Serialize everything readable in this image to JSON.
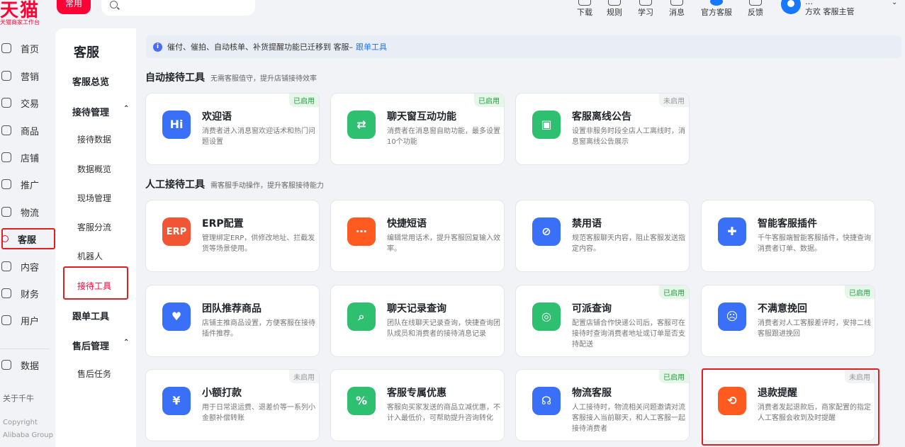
{
  "brand": {
    "logo": "天猫",
    "subtitle": "天猫商家工作台"
  },
  "topbar": {
    "common_tab": "常用",
    "tools": [
      {
        "label": "下载",
        "icon": "download-icon"
      },
      {
        "label": "规则",
        "icon": "rules-icon"
      },
      {
        "label": "学习",
        "icon": "learn-icon"
      },
      {
        "label": "消息",
        "icon": "message-icon"
      },
      {
        "label": "官方客服",
        "icon": "support-icon"
      },
      {
        "label": "反馈",
        "icon": "feedback-icon"
      }
    ],
    "user": {
      "name": "…",
      "role": "方欢  客服主管"
    }
  },
  "leftnav": {
    "items": [
      {
        "label": "首页"
      },
      {
        "label": "营销"
      },
      {
        "label": "交易"
      },
      {
        "label": "商品"
      },
      {
        "label": "店铺"
      },
      {
        "label": "推广"
      },
      {
        "label": "物流"
      },
      {
        "label": "客服"
      },
      {
        "label": "内容"
      },
      {
        "label": "财务"
      },
      {
        "label": "用户"
      },
      {
        "label": "数据"
      }
    ],
    "about": "关于千牛",
    "copyright_1": "Copyright",
    "copyright_2": "Alibaba Group"
  },
  "subnav": {
    "title": "客服",
    "overview": "客服总览",
    "group1": "接待管理",
    "group1_items": [
      "接待数据",
      "数据概览",
      "现场管理",
      "客服分流",
      "机器人",
      "接待工具"
    ],
    "group2": "跟单工具",
    "group3": "售后管理",
    "group3_items": [
      "售后任务"
    ]
  },
  "notice": {
    "text": "催付、催拍、自动核单、补货提醒功能已迁移到 客服–",
    "link": "跟单工具"
  },
  "sections": {
    "auto": {
      "title": "自动接待工具",
      "subtitle": "无需客服值守，提升店铺接待效率"
    },
    "manual": {
      "title": "人工接待工具",
      "subtitle": "需客服手动操作，提升客服接待能力"
    }
  },
  "cards": [
    {
      "title": "欢迎语",
      "desc": "消费者进入消息窗欢迎话术和热门问题设置",
      "badge": "已启用",
      "status": "on",
      "icon": "hi-icon",
      "glyph": "Hi",
      "color": "#3a6ff7"
    },
    {
      "title": "聊天窗互动功能",
      "desc": "消费者在消息窗自助功能，最多设置10个功能",
      "badge": "已启用",
      "status": "on",
      "icon": "swap-icon",
      "glyph": "⇄",
      "color": "#2fbf71"
    },
    {
      "title": "客服离线公告",
      "desc": "设置非服务时段全店人工离线时，消息窗离线公告展示",
      "badge": "未启用",
      "status": "off",
      "icon": "screen-icon",
      "glyph": "▣",
      "color": "#2fbf71"
    },
    {
      "title": "ERP配置",
      "desc": "管理绑定ERP，供修改地址、拦截发货等场景使用。",
      "badge": "",
      "status": "",
      "icon": "erp-icon",
      "glyph": "ERP",
      "color": "#f25533"
    },
    {
      "title": "快捷短语",
      "desc": "编辑常用话术，提升客服回复输入效率。",
      "badge": "",
      "status": "",
      "icon": "quick-phrase-icon",
      "glyph": "⋯",
      "color": "#ff5a1f"
    },
    {
      "title": "禁用语",
      "desc": "规范客服聊天内容，阻止客服发送指定内容。",
      "badge": "",
      "status": "",
      "icon": "ban-icon",
      "glyph": "⊘",
      "color": "#3a6ff7"
    },
    {
      "title": "智能客服插件",
      "desc": "千牛客服端智能客服插件，快捷查询消费者订单、数据。",
      "badge": "",
      "status": "",
      "icon": "puzzle-icon",
      "glyph": "✚",
      "color": "#3a6ff7"
    },
    {
      "title": "团队推荐商品",
      "desc": "店铺主推商品设置，方便客服在接待插件推荐。",
      "badge": "",
      "status": "",
      "icon": "heart-icon",
      "glyph": "♥",
      "color": "#3a6ff7"
    },
    {
      "title": "聊天记录查询",
      "desc": "团队在线聊天记录查询，快捷查询团队成员和消费者的接待消息记录",
      "badge": "",
      "status": "",
      "icon": "chat-history-icon",
      "glyph": "⌕",
      "color": "#2fbf71"
    },
    {
      "title": "可派查询",
      "desc": "配置店铺合作快递公司后，客服可在接待时查询消费者地址或订单是否支持配送",
      "badge": "已启用",
      "status": "on",
      "icon": "location-search-icon",
      "glyph": "◎",
      "color": "#2fbf71"
    },
    {
      "title": "不满意挽回",
      "desc": "消费者对人工客服差评时，安排二线客服跟进挽回",
      "badge": "已启用",
      "status": "on",
      "icon": "sad-face-icon",
      "glyph": "☹",
      "color": "#3a6ff7"
    },
    {
      "title": "小额打款",
      "desc": "用于日常退运费、退差价等一系列小金额补偿转账",
      "badge": "未启用",
      "status": "off",
      "icon": "yen-icon",
      "glyph": "¥",
      "color": "#3a6ff7"
    },
    {
      "title": "客服专属优惠",
      "desc": "客服向买家发送的商品立减优惠，不计入最低价，可帮助提升咨询转化",
      "badge": "",
      "status": "",
      "icon": "coupon-icon",
      "glyph": "%",
      "color": "#2fbf71"
    },
    {
      "title": "物流客服",
      "desc": "人工接待时，物流相关问题邀请对流客服接入当前聊天，和人工客服一起接待消费者",
      "badge": "已启用",
      "status": "on",
      "icon": "headset-icon",
      "glyph": "☊",
      "color": "#3a6ff7"
    },
    {
      "title": "退款提醒",
      "desc": "消费者发起退款后，商家配置的指定人工客服会收到及时提醒",
      "badge": "未启用",
      "status": "off",
      "icon": "refund-icon",
      "glyph": "⟲",
      "color": "#ff5a1f"
    }
  ]
}
